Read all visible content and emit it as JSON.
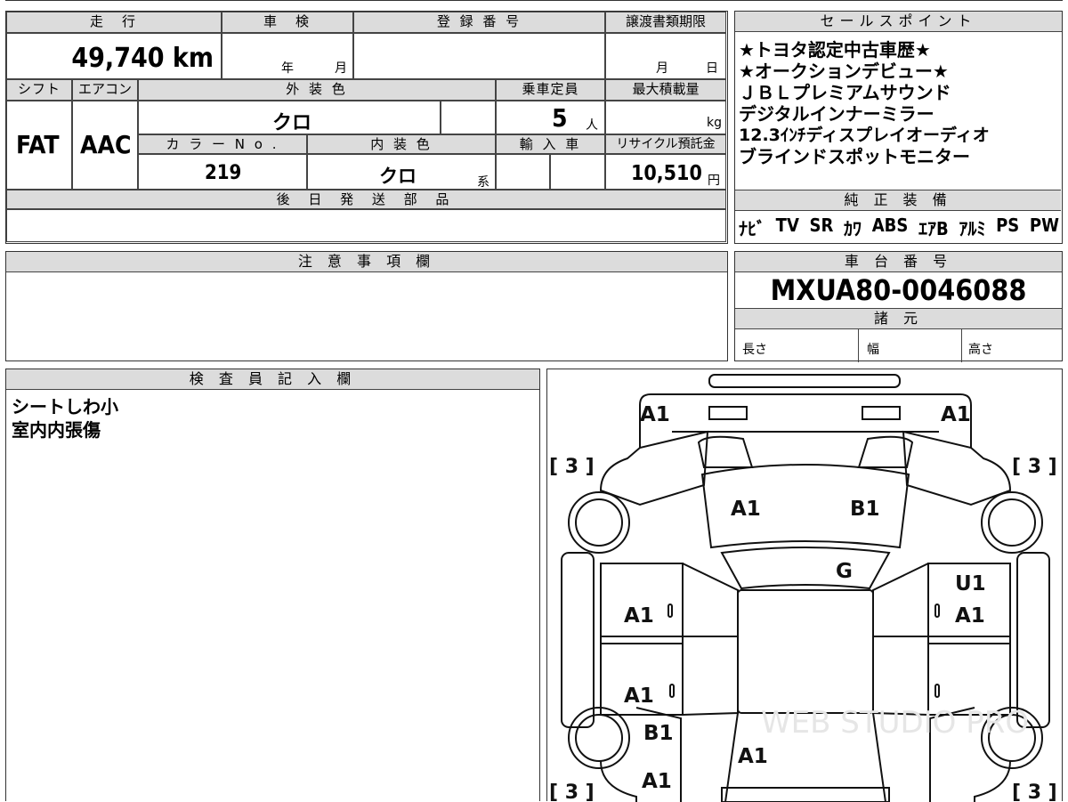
{
  "spec_table": {
    "mileage_header": "走　行",
    "mileage_value": "49,740",
    "mileage_unit": "km",
    "inspection_header": "車　検",
    "inspection_year": "年",
    "inspection_month": "月",
    "registration_header": "登 録 番 号",
    "transfer_header": "譲渡書類期限",
    "transfer_month": "月",
    "transfer_day": "日",
    "shift_header": "シフト",
    "shift_value": "FAT",
    "ac_header": "エアコン",
    "ac_value": "AAC",
    "exterior_header": "外 装 色",
    "exterior_value": "クロ",
    "capacity_header": "乗車定員",
    "capacity_value": "5",
    "capacity_unit": "人",
    "load_header": "最大積載量",
    "load_unit": "kg",
    "color_no_header": "カ ラ ー N o .",
    "color_no_value": "219",
    "interior_header": "内 装 色",
    "interior_value": "クロ",
    "interior_suffix": "系",
    "import_header": "輸 入 車",
    "recycle_header": "リサイクル預託金",
    "recycle_value": "10,510",
    "recycle_unit": "円",
    "parts_header": "後 日 発 送 部 品"
  },
  "sales_points": {
    "header": "セールスポイント",
    "lines": [
      "★トヨタ認定中古車歴★",
      "★オークションデビュー★",
      "ＪＢＬプレミアムサウンド",
      "デジタルインナーミラー",
      "12.3ｲﾝﾁディスプレイオーディオ",
      "ブラインドスポットモニター"
    ]
  },
  "equipment": {
    "header": "純 正 装 備",
    "items": [
      "ﾅﾋﾞ",
      "TV",
      "SR",
      "ｶﾜ",
      "ABS",
      "ｴｱB",
      "ｱﾙﾐ",
      "PS",
      "PW"
    ]
  },
  "notes": {
    "header": "注 意 事 項 欄"
  },
  "chassis": {
    "header": "車 台 番 号",
    "value": "MXUA80-0046088",
    "specs_header": "諸 元",
    "length_label": "長さ",
    "width_label": "幅",
    "height_label": "高さ"
  },
  "inspector": {
    "header": "検 査 員 記 入 欄",
    "lines": [
      "シートしわ小",
      "室内内張傷"
    ]
  },
  "diagram": {
    "marks": {
      "front_left": "A1",
      "front_right": "A1",
      "hood_left": "A1",
      "hood_right": "B1",
      "windshield": "G",
      "front_right_door_top": "U1",
      "front_left_door": "A1",
      "front_right_door": "A1",
      "rear_left_door": "A1",
      "rear_left_fender": "B1",
      "rear_left_corner": "A1",
      "trunk": "A1"
    },
    "tire_tl": "[ 3 ]",
    "tire_tr": "[ 3 ]",
    "tire_bl": "[ 3 ]",
    "tire_br": "[ 3 ]",
    "watermark": "WEB STUDIO PRO"
  }
}
